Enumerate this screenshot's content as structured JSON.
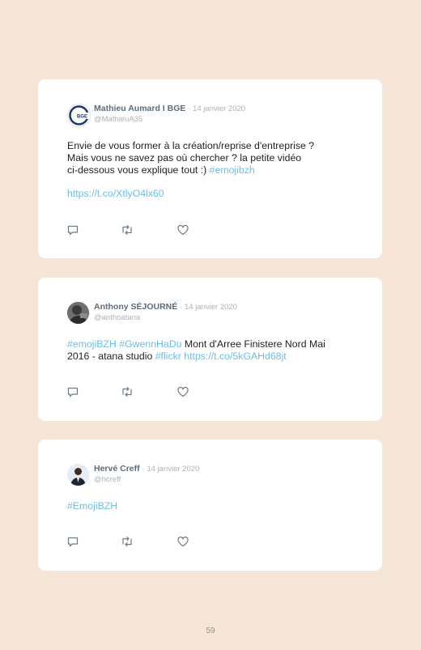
{
  "tweets": [
    {
      "name": "Mathieu Aumard I BGE",
      "date": "· 14 janvier 2020",
      "handle": "@MathieuA35",
      "lines": [
        "Envie de vous former à la création/reprise d'entreprise ?",
        "Mais vous ne savez pas où chercher ? la petite vidéo"
      ],
      "line3_text": "ci-dessous vous explique tout :)",
      "line3_hashtag": "#emojibzh",
      "url": "https://t.co/XtlyO4lx60",
      "avatar_text": "BGE"
    },
    {
      "name": "Anthony SÉJOURNÉ",
      "date": "· 14 janvier 2020",
      "handle": "@anthoatana",
      "tag1": "#emojiBZH",
      "tag2": "#GwennHaDu",
      "text1": "Mont d'Arree Finistere Nord Mai",
      "text2": "2016 - atana studio",
      "tag3": "#flickr",
      "url": "https://t.co/5kGAHd68jt"
    },
    {
      "name": "Hervé Creff",
      "date": "· 14 janvier 2020",
      "handle": "@hcreff",
      "tag1": "#EmojiBZH"
    }
  ],
  "page_number": "59",
  "icons": [
    "reply-icon",
    "retweet-icon",
    "like-icon"
  ],
  "colors": {
    "background": "#f5e6d8",
    "link": "#6bbfe6",
    "name": "#5d6b78",
    "muted": "#a9b2ba"
  }
}
